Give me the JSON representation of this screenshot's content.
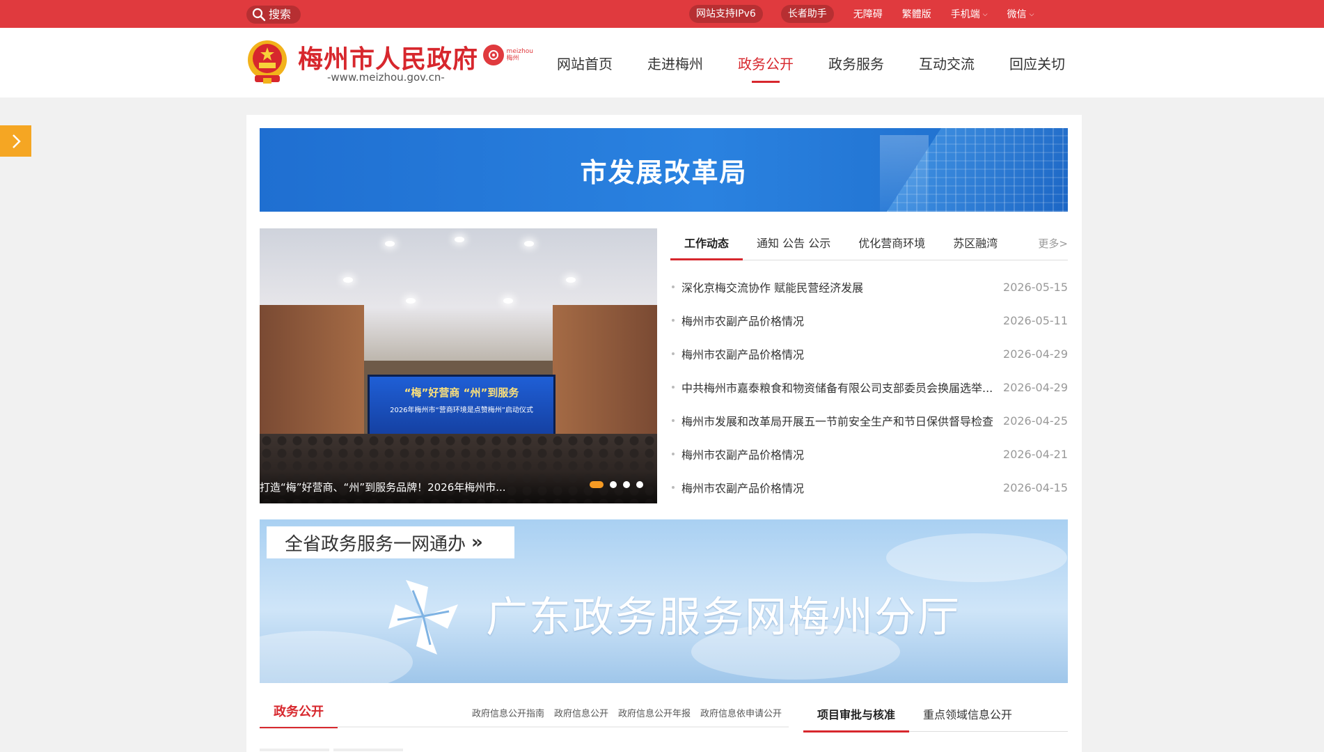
{
  "topbar": {
    "search_label": "搜索",
    "links": [
      "网站支持IPv6",
      "长者助手",
      "无障碍",
      "繁體版",
      "手机端",
      "微信"
    ]
  },
  "header": {
    "site_name": "梅州市人民政府",
    "site_url": "-www.meizhou.gov.cn-",
    "mini_logo_line1": "meizhou",
    "mini_logo_line2": "梅州",
    "nav": [
      "网站首页",
      "走进梅州",
      "政务公开",
      "政务服务",
      "互动交流",
      "回应关切"
    ],
    "active_nav": "政务公开"
  },
  "banner": {
    "title": "市发展改革局"
  },
  "slideshow": {
    "screen_line1": "“梅”好营商  “州”到服务",
    "screen_line2": "2026年梅州市“营商环境是点赞梅州”启动仪式",
    "caption": "打造“梅”好营商、“州”到服务品牌！2026年梅州市...",
    "dots": 4,
    "active_dot": 0
  },
  "news": {
    "tabs": [
      "工作动态",
      "通知 公告 公示",
      "优化营商环境",
      "苏区融湾"
    ],
    "active_tab": "工作动态",
    "more_label": "更多>",
    "items": [
      {
        "title": "深化京梅交流协作 赋能民营经济发展",
        "date": "2026-05-15"
      },
      {
        "title": "梅州市农副产品价格情况",
        "date": "2026-05-11"
      },
      {
        "title": "梅州市农副产品价格情况",
        "date": "2026-04-29"
      },
      {
        "title": "中共梅州市嘉泰粮食和物资储备有限公司支部委员会换届选举...",
        "date": "2026-04-29"
      },
      {
        "title": "梅州市发展和改革局开展五一节前安全生产和节日保供督导检查",
        "date": "2026-04-25"
      },
      {
        "title": "梅州市农副产品价格情况",
        "date": "2026-04-21"
      },
      {
        "title": "梅州市农副产品价格情况",
        "date": "2026-04-15"
      }
    ]
  },
  "service": {
    "button_label": "全省政务服务一网通办",
    "button_arrow": "»",
    "title": "广东政务服务网梅州分厅"
  },
  "bottom": {
    "left_label": "政务公开",
    "left_links": [
      "政府信息公开指南",
      "政府信息公开",
      "政府信息公开年报",
      "政府信息依申请公开"
    ],
    "right_tabs": [
      "项目审批与核准",
      "重点领域信息公开"
    ],
    "right_active": "项目审批与核准"
  },
  "colors": {
    "brand_red": "#e03a3e",
    "title_red": "#d7272d",
    "accent_orange": "#f5a623",
    "banner_blue": "#2a82e0"
  }
}
